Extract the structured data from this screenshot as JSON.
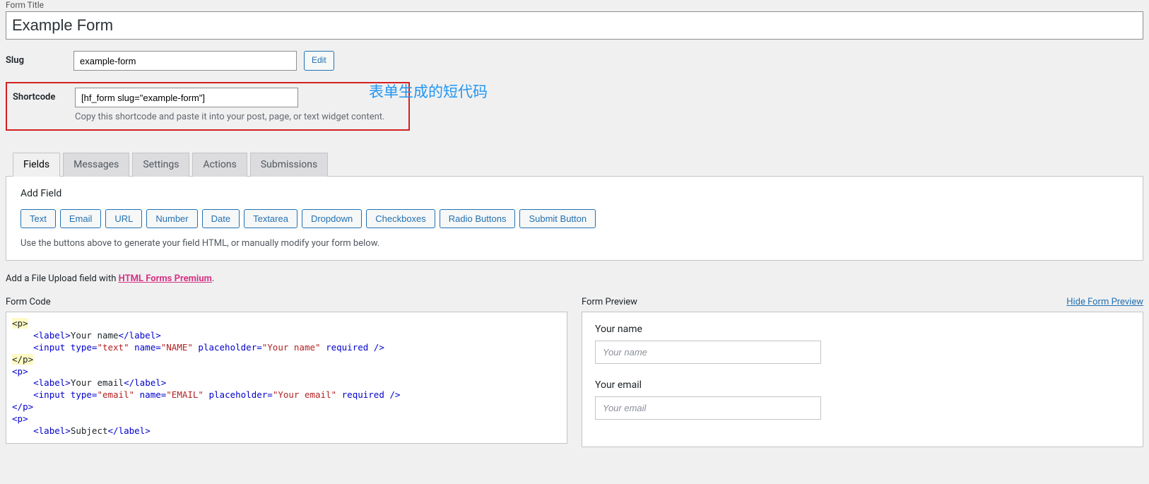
{
  "form_title_label": "Form Title",
  "form_title_value": "Example Form",
  "slug_label": "Slug",
  "slug_value": "example-form",
  "edit_button": "Edit",
  "shortcode_label": "Shortcode",
  "shortcode_value": "[hf_form slug=\"example-form\"]",
  "shortcode_help": "Copy this shortcode and paste it into your post, page, or text widget content.",
  "annotation_text": "表单生成的短代码",
  "tabs": {
    "fields": "Fields",
    "messages": "Messages",
    "settings": "Settings",
    "actions": "Actions",
    "submissions": "Submissions"
  },
  "add_field_heading": "Add Field",
  "field_buttons": {
    "text": "Text",
    "email": "Email",
    "url": "URL",
    "number": "Number",
    "date": "Date",
    "textarea": "Textarea",
    "dropdown": "Dropdown",
    "checkboxes": "Checkboxes",
    "radio": "Radio Buttons",
    "submit": "Submit Button"
  },
  "field_help": "Use the buttons above to generate your field HTML, or manually modify your form below.",
  "upsell_prefix": "Add a File Upload field with ",
  "upsell_link": "HTML Forms Premium",
  "upsell_suffix": ".",
  "form_code_label": "Form Code",
  "form_preview_label": "Form Preview",
  "hide_preview_link": "Hide Form Preview",
  "code": {
    "l1": "<p>",
    "l2a": "    <",
    "l2b": "label",
    "l2c": ">",
    "l2d": "Your name",
    "l2e": "</",
    "l2f": "label",
    "l2g": ">",
    "l3a": "    <",
    "l3b": "input",
    "l3c": " type=",
    "l3d": "\"text\"",
    "l3e": " name=",
    "l3f": "\"NAME\"",
    "l3g": " placeholder=",
    "l3h": "\"Your name\"",
    "l3i": " required />",
    "l4": "</p>",
    "l5a": "<",
    "l5b": "p",
    "l5c": ">",
    "l6a": "    <",
    "l6b": "label",
    "l6c": ">",
    "l6d": "Your email",
    "l6e": "</",
    "l6f": "label",
    "l6g": ">",
    "l7a": "    <",
    "l7b": "input",
    "l7c": " type=",
    "l7d": "\"email\"",
    "l7e": " name=",
    "l7f": "\"EMAIL\"",
    "l7g": " placeholder=",
    "l7h": "\"Your email\"",
    "l7i": " required />",
    "l8a": "</",
    "l8b": "p",
    "l8c": ">",
    "l9a": "<",
    "l9b": "p",
    "l9c": ">",
    "l10a": "    <",
    "l10b": "label",
    "l10c": ">",
    "l10d": "Subject",
    "l10e": "</",
    "l10f": "label",
    "l10g": ">"
  },
  "preview": {
    "name_label": "Your name",
    "name_placeholder": "Your name",
    "email_label": "Your email",
    "email_placeholder": "Your email"
  }
}
